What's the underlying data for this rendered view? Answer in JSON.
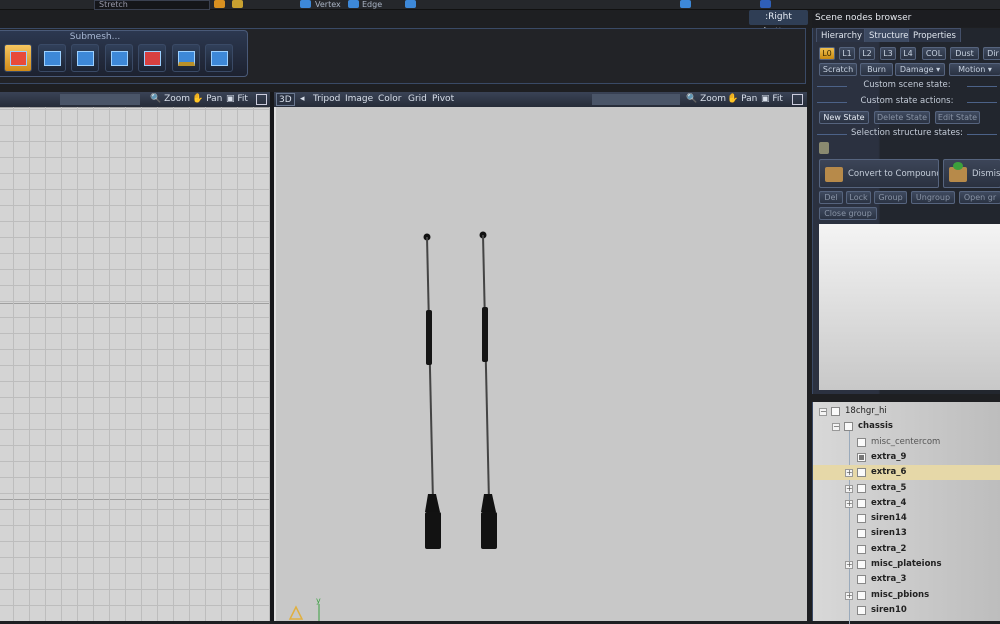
{
  "toolbar": {
    "field_value": "Stretch",
    "vertex_label": "Vertex",
    "edge_label": "Edge"
  },
  "right_button_label": ":Right button",
  "scene_browser_title": "Scene nodes browser",
  "ribbon": {
    "group_title": "Submesh...",
    "tool_icons": [
      "submesh-split-icon",
      "submesh-detach-icon",
      "submesh-extrude-icon",
      "submesh-cut-icon",
      "submesh-triangulate-icon",
      "submesh-bevel-icon",
      "submesh-weld-icon"
    ]
  },
  "left_viewport": {
    "zoom": "Zoom",
    "pan": "Pan",
    "fit": "Fit"
  },
  "main_viewport": {
    "mode": "3D",
    "menus": [
      "Tripod",
      "Image",
      "Color",
      "Grid",
      "Pivot"
    ],
    "zoom": "Zoom",
    "pan": "Pan",
    "fit": "Fit"
  },
  "panel": {
    "tabs": [
      "Hierarchy",
      "Structure",
      "Properties"
    ],
    "selected_tab": "Structure",
    "lod_buttons": [
      "L0",
      "L1",
      "L2",
      "L3",
      "L4",
      "COL",
      "Dust",
      "Dir"
    ],
    "state_buttons": [
      "Scratch",
      "Burn",
      "Damage",
      "Motion"
    ],
    "custom_scene_state": "Custom scene state:",
    "custom_state_actions": "Custom state actions:",
    "action_buttons": [
      "New State",
      "Delete State",
      "Edit State"
    ],
    "selection_structure_states": "Selection structure states:",
    "convert_label": "Convert to Compound",
    "dismiss_label": "Dismiss",
    "group_buttons": [
      "Del",
      "Lock",
      "Group",
      "Ungroup",
      "Open gr"
    ],
    "close_group": "Close group"
  },
  "tree": [
    {
      "label": "18chgr_hi",
      "level": 0,
      "expander": "minus",
      "bold": false
    },
    {
      "label": "chassis",
      "level": 1,
      "expander": "minus",
      "bold": true
    },
    {
      "label": "misc_centercom",
      "level": 2,
      "expander": "",
      "bold": false
    },
    {
      "label": "extra_9",
      "level": 2,
      "expander": "",
      "bold": true,
      "partial": true
    },
    {
      "label": "extra_6",
      "level": 2,
      "expander": "plus",
      "bold": true,
      "highlighted": true
    },
    {
      "label": "extra_5",
      "level": 2,
      "expander": "plus",
      "bold": true
    },
    {
      "label": "extra_4",
      "level": 2,
      "expander": "plus",
      "bold": true
    },
    {
      "label": "siren14",
      "level": 2,
      "expander": "",
      "bold": true
    },
    {
      "label": "siren13",
      "level": 2,
      "expander": "",
      "bold": true
    },
    {
      "label": "extra_2",
      "level": 2,
      "expander": "",
      "bold": true
    },
    {
      "label": "misc_plateions",
      "level": 2,
      "expander": "plus",
      "bold": true
    },
    {
      "label": "extra_3",
      "level": 2,
      "expander": "",
      "bold": true
    },
    {
      "label": "misc_pbions",
      "level": 2,
      "expander": "plus",
      "bold": true
    },
    {
      "label": "siren10",
      "level": 2,
      "expander": "",
      "bold": true
    }
  ],
  "axis_label": "y"
}
